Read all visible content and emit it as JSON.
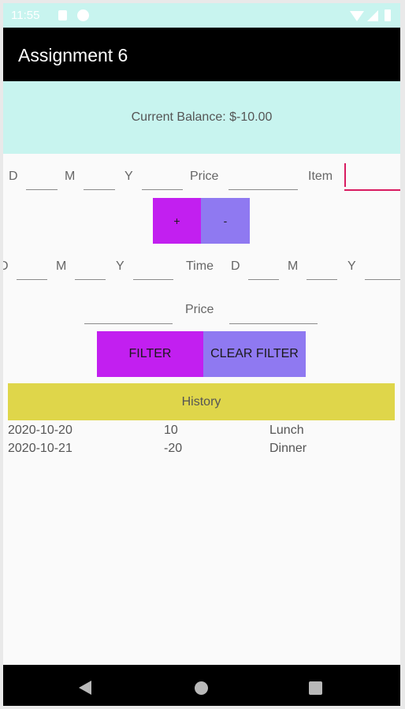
{
  "status_bar": {
    "time": "11:55",
    "icons": [
      "sd-card-icon",
      "play-protect-icon",
      "wifi-icon",
      "signal-icon",
      "battery-icon"
    ]
  },
  "app_bar": {
    "title": "Assignment 6"
  },
  "balance": {
    "text": "Current Balance: $-10.00"
  },
  "entry": {
    "d_label": "D",
    "m_label": "M",
    "y_label": "Y",
    "price_label": "Price",
    "item_label": "Item",
    "d_value": "",
    "m_value": "",
    "y_value": "",
    "price_value": "",
    "item_value": ""
  },
  "buttons": {
    "plus": "+",
    "minus": "-",
    "filter": "FILTER",
    "clear_filter": "CLEAR FILTER"
  },
  "filter": {
    "d_from": "D",
    "m_from": "M",
    "y_from": "Y",
    "time_label": "Time",
    "d_to": "D",
    "m_to": "M",
    "y_to": "Y",
    "price_label": "Price",
    "price_min": "",
    "price_max": ""
  },
  "history": {
    "title": "History",
    "rows": [
      {
        "date": "2020-10-20",
        "amount": "10",
        "item": "Lunch"
      },
      {
        "date": "2020-10-21",
        "amount": "-20",
        "item": "Dinner"
      }
    ]
  },
  "colors": {
    "accent_teal": "#c8f4ef",
    "purple": "#c21ff0",
    "lavender": "#8f79f1",
    "yellow": "#dfd64a",
    "focus_pink": "#d81b60"
  },
  "nav": {
    "icons": [
      "back-icon",
      "home-icon",
      "recents-icon"
    ]
  }
}
